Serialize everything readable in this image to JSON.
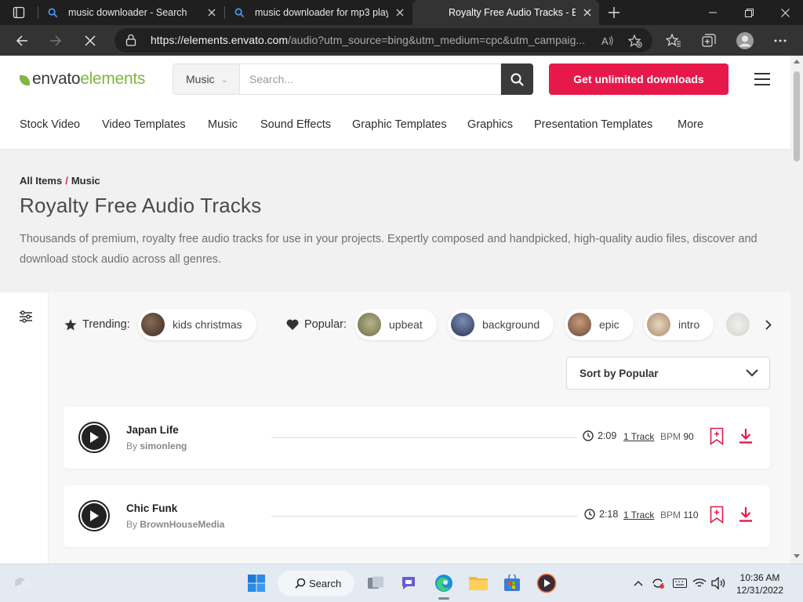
{
  "browser": {
    "tabs": [
      {
        "title": "music downloader - Search",
        "active": false
      },
      {
        "title": "music downloader for mp3 playe",
        "active": false
      },
      {
        "title": "Royalty Free Audio Tracks - Enva",
        "active": true
      }
    ],
    "url_host": "https://elements.envato.com",
    "url_path": "/audio?utm_source=bing&utm_medium=cpc&utm_campaig..."
  },
  "site": {
    "logo_part1": "envato",
    "logo_part2": "elements",
    "search_category": "Music",
    "search_placeholder": "Search...",
    "cta_label": "Get unlimited downloads",
    "nav": [
      "Stock Video",
      "Video Templates",
      "Music",
      "Sound Effects",
      "Graphic Templates",
      "Graphics",
      "Presentation Templates",
      "More"
    ]
  },
  "hero": {
    "breadcrumb_root": "All Items",
    "breadcrumb_sep": "/",
    "breadcrumb_current": "Music",
    "title": "Royalty Free Audio Tracks",
    "description": "Thousands of premium, royalty free audio tracks for use in your projects. Expertly composed and handpicked, high-quality audio files, discover and download stock audio across all genres."
  },
  "filters": {
    "trending_label": "Trending:",
    "popular_label": "Popular:",
    "trending_tags": [
      "kids christmas"
    ],
    "popular_tags": [
      "upbeat",
      "background",
      "epic",
      "intro"
    ],
    "sort_label": "Sort by Popular"
  },
  "tracks": [
    {
      "title": "Japan Life",
      "by": "By",
      "author": "simonleng",
      "duration": "2:09",
      "tracks": "1 Track",
      "bpm_label": "BPM",
      "bpm": "90"
    },
    {
      "title": "Chic Funk",
      "by": "By",
      "author": "BrownHouseMedia",
      "duration": "2:18",
      "tracks": "1 Track",
      "bpm_label": "BPM",
      "bpm": "110"
    }
  ],
  "taskbar": {
    "search_label": "Search",
    "time": "10:36 AM",
    "date": "12/31/2022"
  },
  "colors": {
    "accent": "#e6194a",
    "brand_green": "#82b541"
  }
}
